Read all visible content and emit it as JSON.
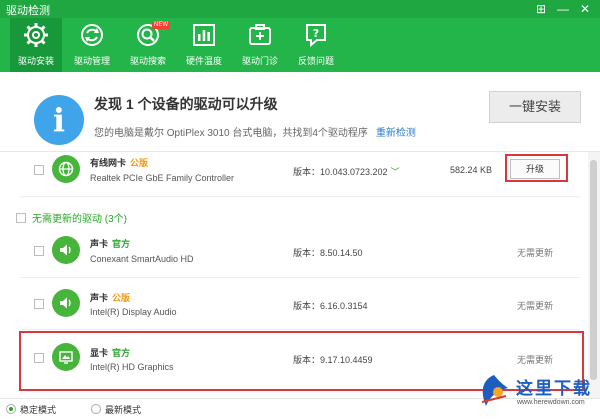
{
  "window": {
    "title": "驱动检测",
    "controls": [
      "⊞",
      "—",
      "✕"
    ]
  },
  "toolbar": {
    "items": [
      {
        "label": "驱动安装",
        "icon": "gear-icon",
        "active": true
      },
      {
        "label": "驱动管理",
        "icon": "refresh-icon"
      },
      {
        "label": "驱动搜索",
        "icon": "search-icon",
        "badge": "NEW"
      },
      {
        "label": "硬件温度",
        "icon": "bar-chart-icon"
      },
      {
        "label": "驱动门诊",
        "icon": "medical-kit-icon"
      },
      {
        "label": "反馈问题",
        "icon": "question-icon"
      }
    ]
  },
  "banner": {
    "title": "发现 1 个设备的驱动可以升级",
    "subtitle": "您的电脑是戴尔 OptiPlex 3010 台式电脑，共找到4个驱动程序",
    "rescan_link": "重新检测",
    "one_click_install": "一键安装"
  },
  "upgradable": [
    {
      "name": "有线网卡",
      "tag": "公版",
      "model": "Realtek PCIe GbE Family Controller",
      "version_label": "版本：10.043.0723.202",
      "chevron": "﹀",
      "size": "582.24 KB",
      "action": "升级",
      "icon": "globe-icon"
    }
  ],
  "no_update_section": {
    "title": "无需更新的驱动 (3个)",
    "items": [
      {
        "name": "声卡",
        "tag": "官方",
        "tag_color": "green",
        "model": "Conexant SmartAudio HD",
        "version_label": "版本：8.50.14.50",
        "status": "无需更新",
        "icon": "speaker-icon"
      },
      {
        "name": "声卡",
        "tag": "公版",
        "tag_color": "orange",
        "model": "Intel(R) Display Audio",
        "version_label": "版本：6.16.0.3154",
        "status": "无需更新",
        "icon": "speaker-icon"
      },
      {
        "name": "显卡",
        "tag": "官方",
        "tag_color": "green",
        "model": "Intel(R) HD Graphics",
        "version_label": "版本：9.17.10.4459",
        "status": "无需更新",
        "icon": "display-icon"
      }
    ]
  },
  "footer": {
    "modes": [
      {
        "label": "稳定模式",
        "selected": true
      },
      {
        "label": "最新模式",
        "selected": false
      }
    ]
  },
  "watermark": {
    "name": "这里下载",
    "url": "www.herewdown.com"
  },
  "colors": {
    "brand_green": "#23b44a",
    "info_blue": "#3fa4ea",
    "highlight_red": "#d9363e",
    "tag_green": "#2aa52a",
    "tag_orange": "#f29a16"
  }
}
